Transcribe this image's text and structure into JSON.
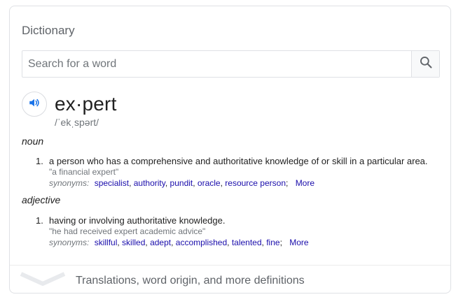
{
  "panel": {
    "title": "Dictionary"
  },
  "search": {
    "placeholder": "Search for a word",
    "value": ""
  },
  "entry": {
    "headword": "ex·pert",
    "phonetic": "/ˈekˌspərt/",
    "meanings": [
      {
        "part_of_speech": "noun",
        "number": "1.",
        "definition": "a person who has a comprehensive and authoritative knowledge of or skill in a particular area.",
        "example": "\"a financial expert\"",
        "synonyms_label": "synonyms:",
        "synonyms": [
          "specialist",
          "authority",
          "pundit",
          "oracle",
          "resource person"
        ],
        "more_label": "More"
      },
      {
        "part_of_speech": "adjective",
        "number": "1.",
        "definition": "having or involving authoritative knowledge.",
        "example": "\"he had received expert academic advice\"",
        "synonyms_label": "synonyms:",
        "synonyms": [
          "skillful",
          "skilled",
          "adept",
          "accomplished",
          "talented",
          "fine"
        ],
        "more_label": "More"
      }
    ]
  },
  "footer": {
    "label": "Translations, word origin, and more definitions"
  },
  "colors": {
    "link": "#1a0dab",
    "accent_blue": "#1a73e8",
    "muted": "#70757a",
    "border": "#dfe1e5"
  },
  "icons": {
    "search": "magnifier-icon",
    "audio": "speaker-icon",
    "expand": "chevron-down-icon"
  }
}
